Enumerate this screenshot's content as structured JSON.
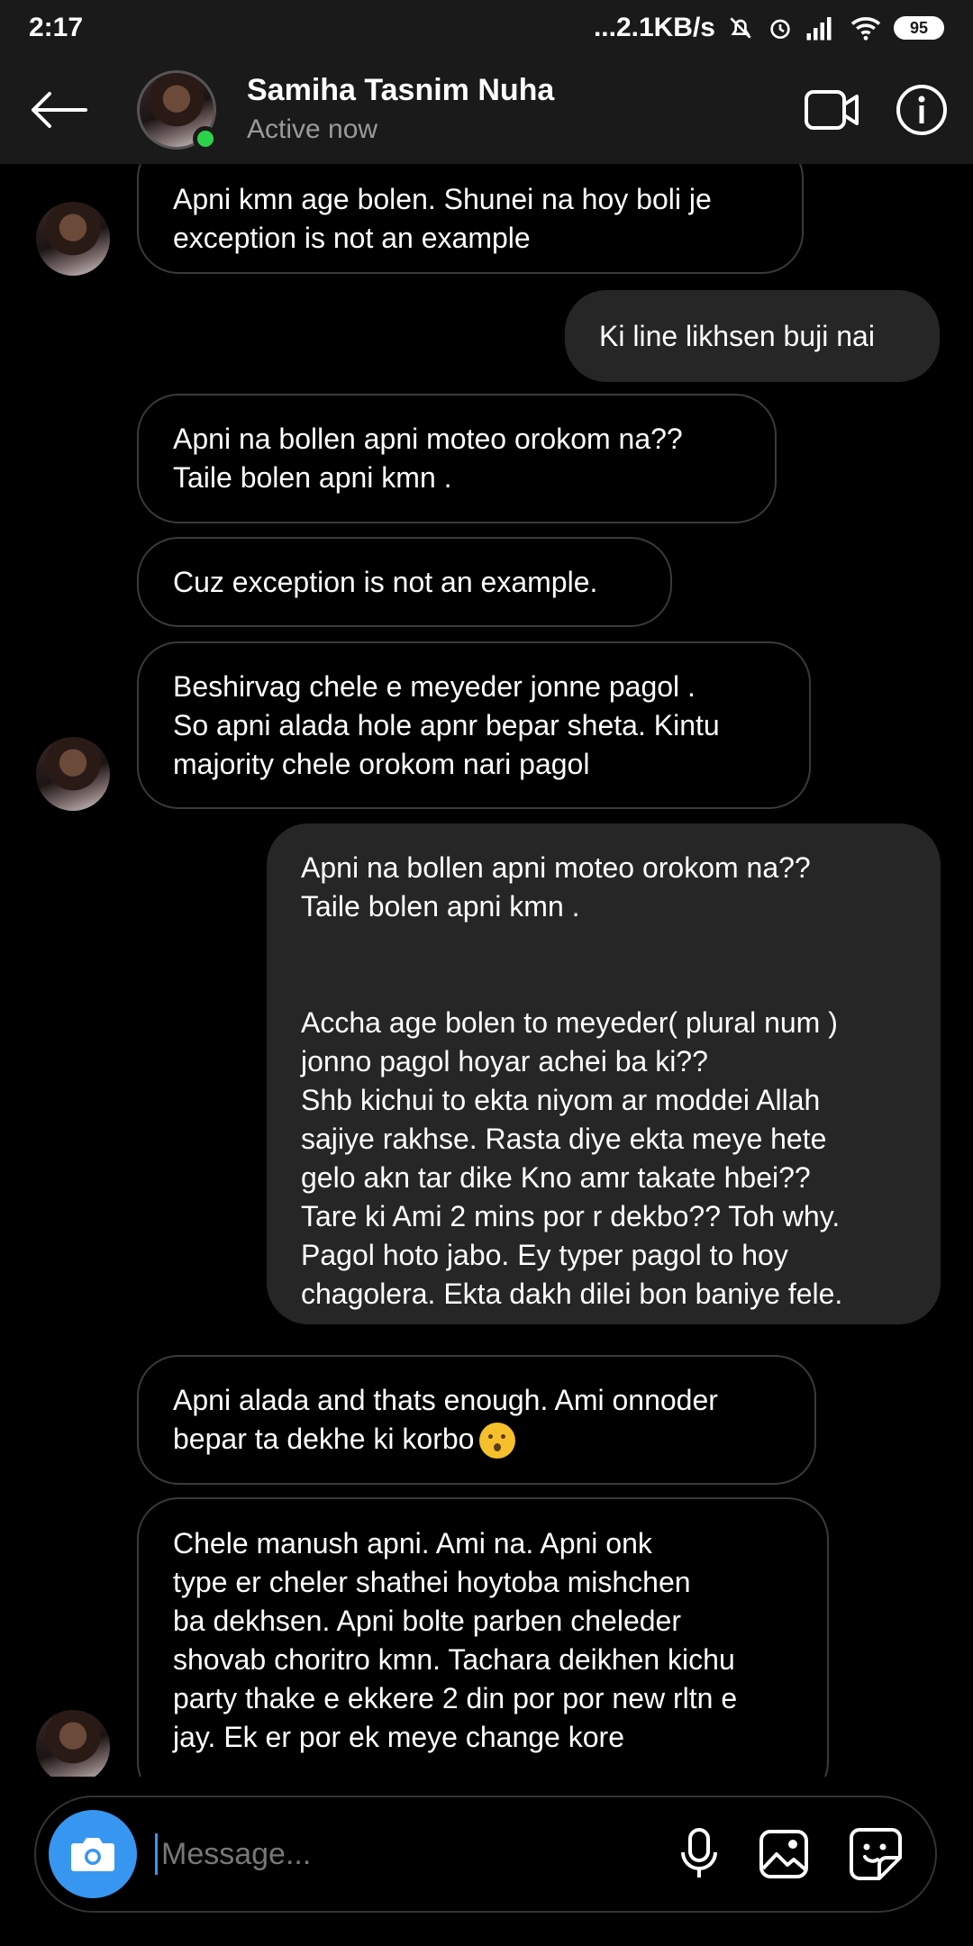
{
  "status_bar": {
    "time": "2:17",
    "network_speed": "...2.1KB/s",
    "battery": "95"
  },
  "header": {
    "name": "Samiha Tasnim Nuha",
    "status": "Active now",
    "icons": [
      "back-arrow-icon",
      "video-call-icon",
      "info-icon"
    ],
    "online_color": "#2bd34b"
  },
  "messages": [
    {
      "side": "in",
      "text": "Apni kmn age bolen. Shunei na hoy boli je\nexception is not an example"
    },
    {
      "side": "out",
      "text": "Ki line likhsen buji nai"
    },
    {
      "side": "in",
      "text": "Apni na bollen apni moteo orokom na??\nTaile bolen apni kmn ."
    },
    {
      "side": "in",
      "text": "Cuz exception is not an example."
    },
    {
      "side": "in",
      "text": "Beshirvag chele e meyeder jonne pagol .\nSo apni alada hole apnr bepar sheta. Kintu\nmajority chele orokom nari pagol"
    },
    {
      "side": "out",
      "text": "Apni na bollen apni moteo orokom na??\nTaile bolen apni kmn .\n\n\nAccha age bolen to meyeder( plural num )\njonno pagol hoyar achei ba ki??\nShb kichui to ekta niyom ar moddei Allah\nsajiye rakhse. Rasta diye ekta meye hete\ngelo akn tar dike Kno amr takate hbei??\nTare ki Ami 2 mins por r dekbo?? Toh why.\nPagol hoto jabo. Ey typer pagol to hoy\nchagolera. Ekta dakh dilei bon baniye fele."
    },
    {
      "side": "in",
      "text": "Apni alada and thats enough. Ami onnoder\nbepar ta dekhe ki korbo",
      "emoji": "kissing-face-emoji"
    },
    {
      "side": "in",
      "text": "Chele manush apni. Ami na. Apni onk\ntype er cheler shathei hoytoba mishchen\nba dekhsen. Apni bolte parben cheleder\nshovab choritro kmn. Tachara deikhen kichu\nparty thake e ekkere 2 din por por new rltn e\njay. Ek er por ek meye change kore"
    }
  ],
  "composer": {
    "placeholder": "Message...",
    "value": "",
    "accent": "#3797f0",
    "icons": [
      "camera-icon",
      "microphone-icon",
      "gallery-icon",
      "sticker-icon"
    ]
  }
}
